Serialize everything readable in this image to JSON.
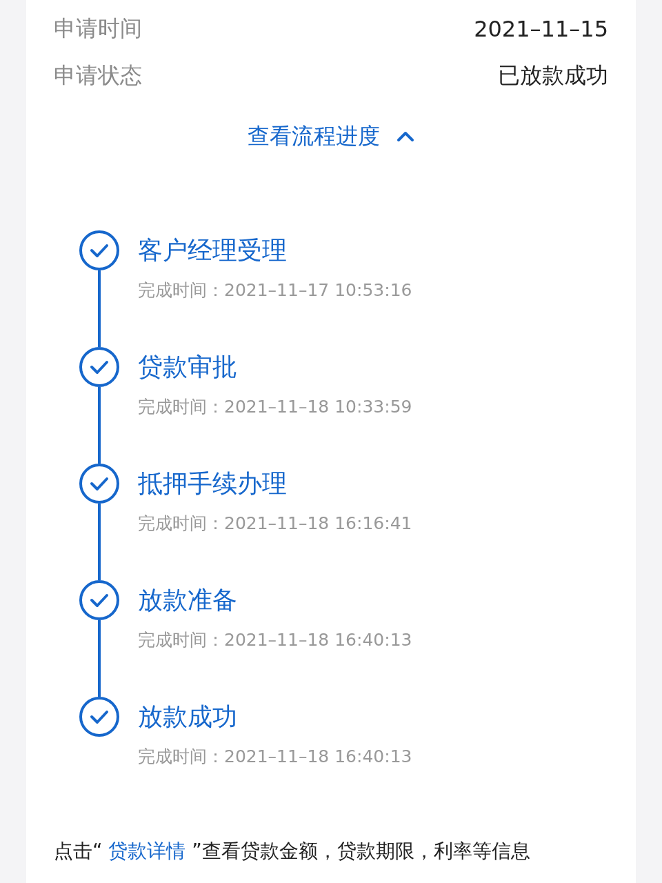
{
  "info_rows": [
    {
      "label": "申请时间",
      "value": "2021–11–15"
    },
    {
      "label": "申请状态",
      "value": "已放款成功"
    }
  ],
  "progress_toggle": {
    "label": "查看流程进度",
    "expanded": true
  },
  "steps": [
    {
      "title": "客户经理受理",
      "time": "完成时间：2021–11–17 10:53:16",
      "completed": true
    },
    {
      "title": "贷款审批",
      "time": "完成时间：2021–11–18 10:33:59",
      "completed": true
    },
    {
      "title": "抵押手续办理",
      "time": "完成时间：2021–11–18 16:16:41",
      "completed": true
    },
    {
      "title": "放款准备",
      "time": "完成时间：2021–11–18 16:40:13",
      "completed": true
    },
    {
      "title": "放款成功",
      "time": "完成时间：2021–11–18 16:40:13",
      "completed": true
    }
  ],
  "footer": {
    "prefix": "点击“ ",
    "link": "贷款详情",
    "suffix": " ”查看贷款金额，贷款期限，利率等信息"
  }
}
